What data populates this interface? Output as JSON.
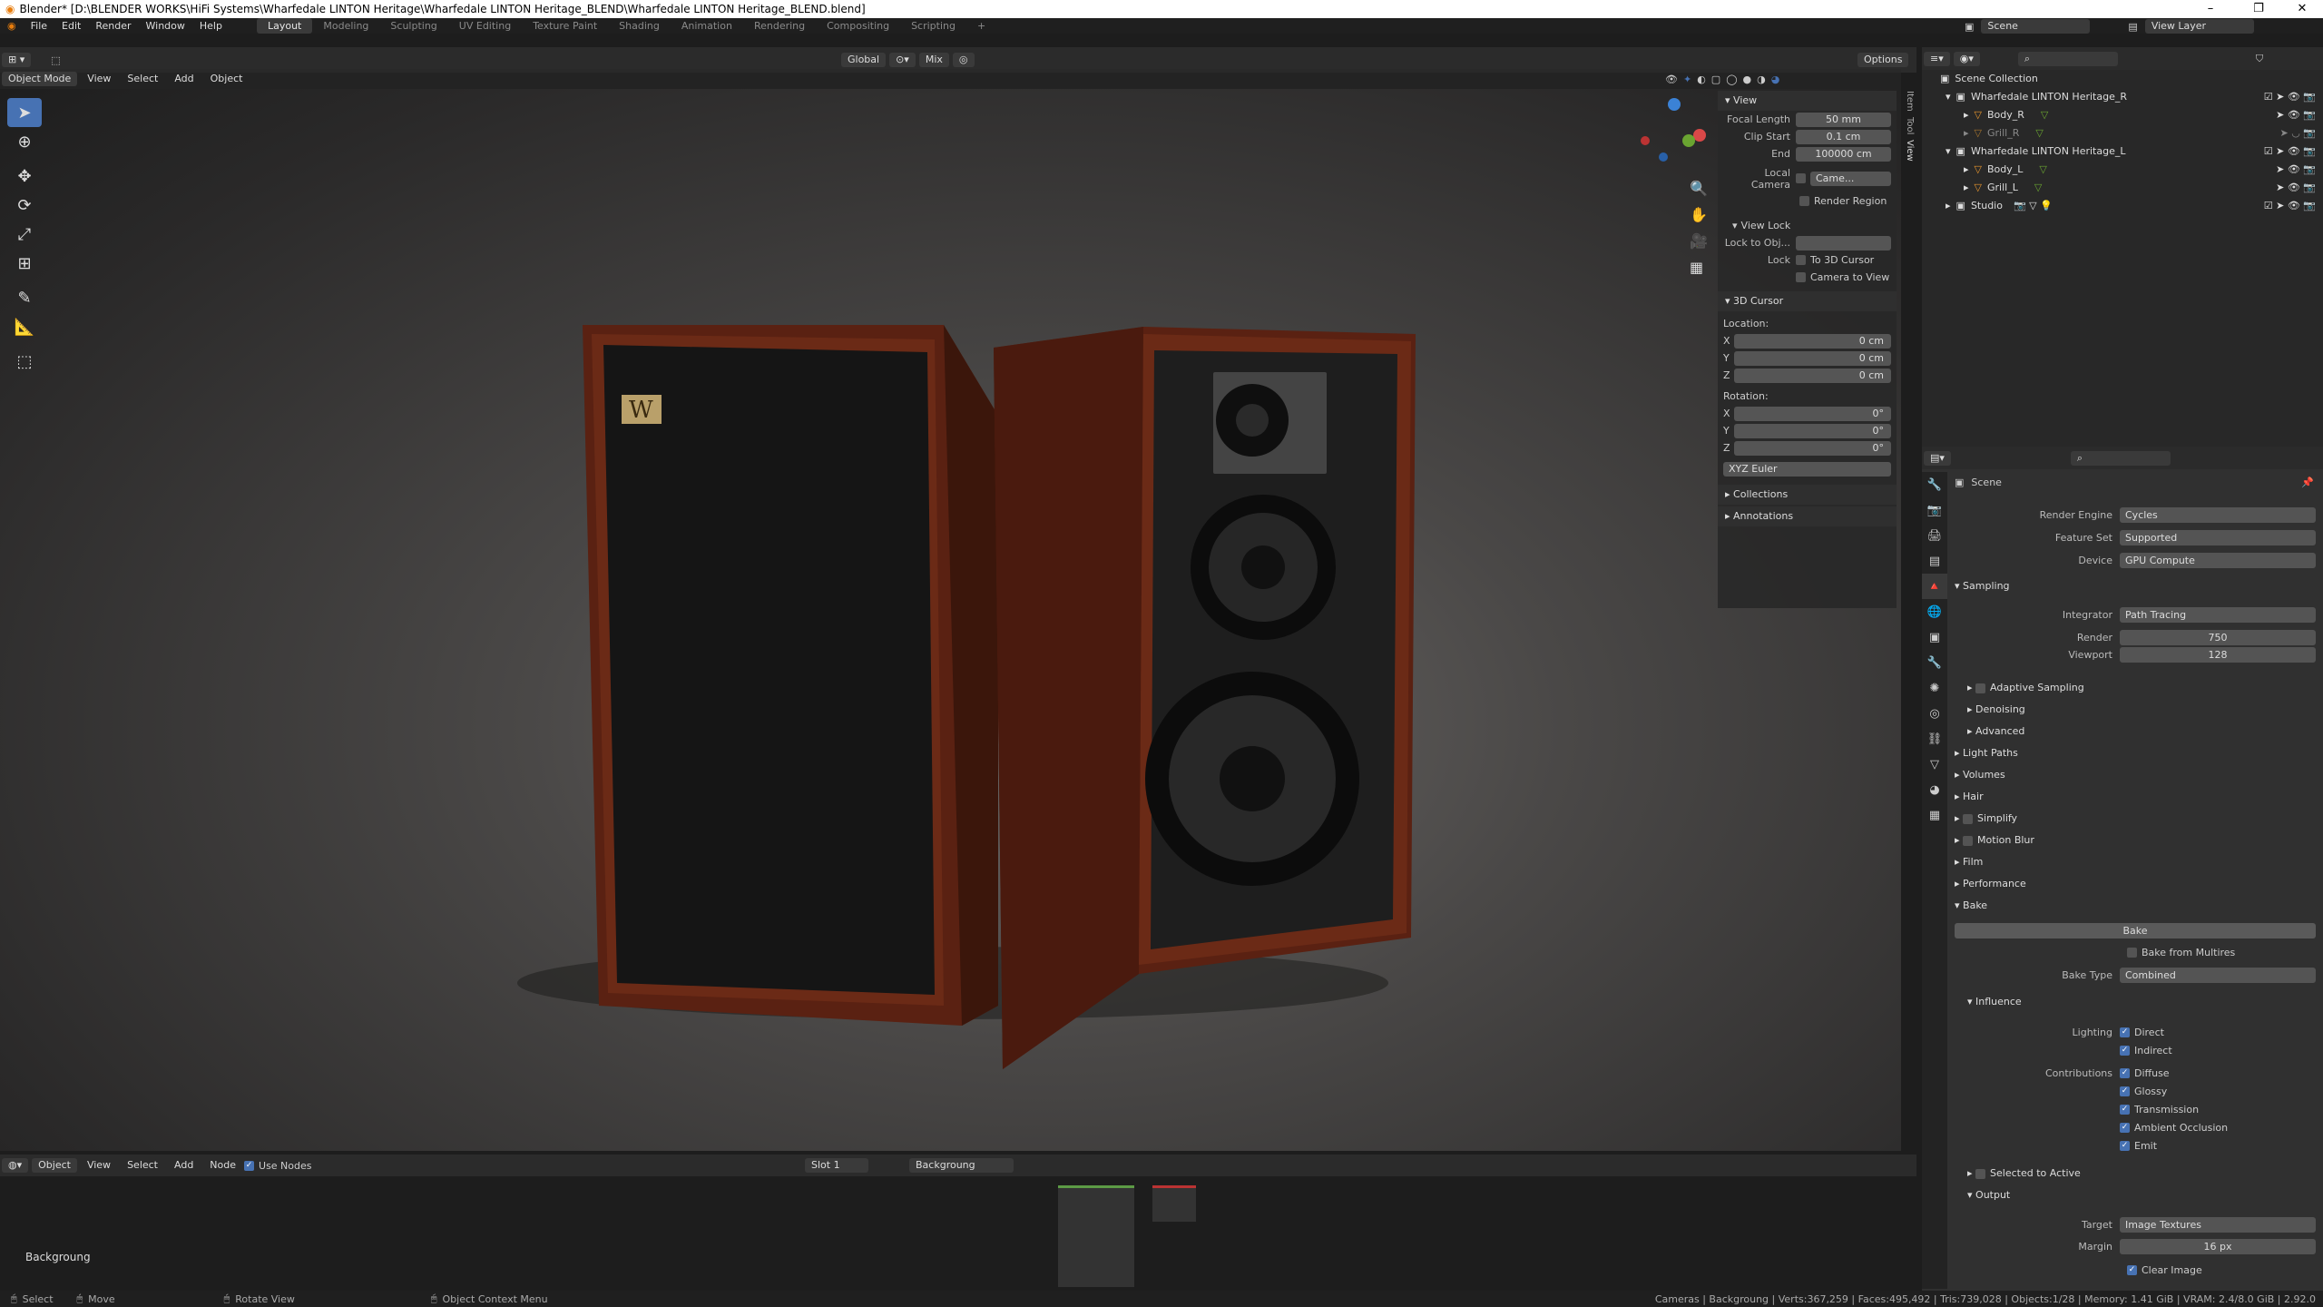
{
  "window": {
    "title": "Blender* [D:\\BLENDER WORKS\\HiFi Systems\\Wharfedale LINTON Heritage\\Wharfedale LINTON Heritage_BLEND\\Wharfedale LINTON Heritage_BLEND.blend]",
    "minimize": "–",
    "maximize": "❐",
    "close": "✕"
  },
  "menu": [
    "File",
    "Edit",
    "Render",
    "Window",
    "Help"
  ],
  "workspaces": [
    "Layout",
    "Modeling",
    "Sculpting",
    "UV Editing",
    "Texture Paint",
    "Shading",
    "Animation",
    "Rendering",
    "Compositing",
    "Scripting",
    "+"
  ],
  "scene_name": "Scene",
  "view_layer": "View Layer",
  "viewport_header": {
    "mode": "Object Mode",
    "view": "View",
    "select": "Select",
    "add": "Add",
    "object": "Object",
    "transform": "Global",
    "snap": "Mix",
    "options": "Options"
  },
  "npanel": {
    "tabs": [
      "Item",
      "Tool",
      "View"
    ],
    "view_title": "View",
    "focal_label": "Focal Length",
    "focal": "50 mm",
    "clip_start_label": "Clip Start",
    "clip_start": "0.1 cm",
    "end_label": "End",
    "end": "100000 cm",
    "local_camera_label": "Local Camera",
    "local_camera": "Came...",
    "render_region": "Render Region",
    "view_lock": "View Lock",
    "lock_to_obj": "Lock to Obj...",
    "lock": "Lock",
    "to_3d_cursor": "To 3D Cursor",
    "camera_to_view": "Camera to View",
    "cursor_title": "3D Cursor",
    "location": "Location:",
    "loc_x": "0 cm",
    "loc_y": "0 cm",
    "loc_z": "0 cm",
    "rotation": "Rotation:",
    "rot_x": "0°",
    "rot_y": "0°",
    "rot_z": "0°",
    "rot_mode": "XYZ Euler",
    "collections": "Collections",
    "annotations": "Annotations",
    "x": "X",
    "y": "Y",
    "z": "Z"
  },
  "outliner": {
    "root": "Scene Collection",
    "items": [
      {
        "name": "Wharfedale LINTON Heritage_R",
        "depth": 1
      },
      {
        "name": "Body_R",
        "depth": 2
      },
      {
        "name": "Grill_R",
        "depth": 2
      },
      {
        "name": "Wharfedale LINTON Heritage_L",
        "depth": 1
      },
      {
        "name": "Body_L",
        "depth": 2
      },
      {
        "name": "Grill_L",
        "depth": 2
      },
      {
        "name": "Studio",
        "depth": 1
      }
    ]
  },
  "properties": {
    "context": "Scene",
    "render_engine_label": "Render Engine",
    "render_engine": "Cycles",
    "feature_set_label": "Feature Set",
    "feature_set": "Supported",
    "device_label": "Device",
    "device": "GPU Compute",
    "sampling": "Sampling",
    "integrator_label": "Integrator",
    "integrator": "Path Tracing",
    "render_label": "Render",
    "render": "750",
    "viewport_label": "Viewport",
    "viewport": "128",
    "adaptive": "Adaptive Sampling",
    "denoising": "Denoising",
    "advanced": "Advanced",
    "light_paths": "Light Paths",
    "volumes": "Volumes",
    "hair": "Hair",
    "simplify": "Simplify",
    "motion_blur": "Motion Blur",
    "film": "Film",
    "performance": "Performance",
    "bake_section": "Bake",
    "bake_button": "Bake",
    "bake_multires": "Bake from Multires",
    "bake_type_label": "Bake Type",
    "bake_type": "Combined",
    "influence": "Influence",
    "lighting_label": "Lighting",
    "direct": "Direct",
    "indirect": "Indirect",
    "contributions_label": "Contributions",
    "diffuse": "Diffuse",
    "glossy": "Glossy",
    "transmission": "Transmission",
    "ambient_occlusion": "Ambient Occlusion",
    "emit": "Emit",
    "selected_to_active": "Selected to Active",
    "output": "Output",
    "target_label": "Target",
    "target": "Image Textures",
    "margin_label": "Margin",
    "margin": "16 px",
    "clear_image": "Clear Image"
  },
  "node_editor": {
    "type": "Object",
    "view": "View",
    "select": "Select",
    "add": "Add",
    "node": "Node",
    "use_nodes": "Use Nodes",
    "slot": "Slot 1",
    "world": "Backgroung",
    "label": "Backgroung"
  },
  "status": {
    "select": "Select",
    "move": "Move",
    "rotate": "Rotate View",
    "context": "Object Context Menu",
    "stats": "Cameras | Backgroung | Verts:367,259 | Faces:495,492 | Tris:739,028 | Objects:1/28 | Memory: 1.41 GiB | VRAM: 2.4/8.0 GiB | 2.92.0"
  }
}
